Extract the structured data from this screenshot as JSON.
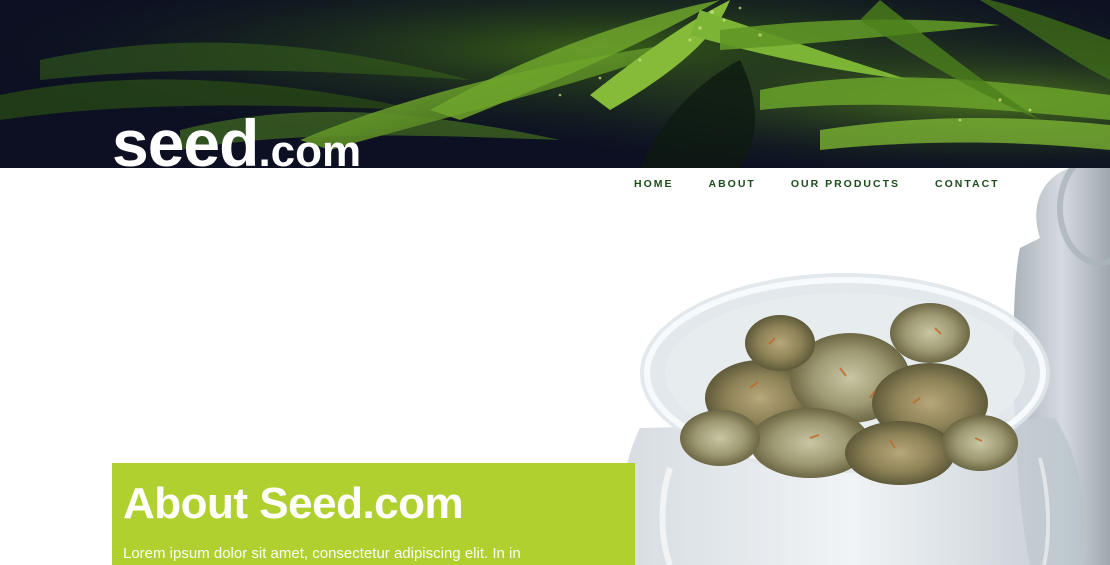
{
  "site": {
    "logo_main": "seed",
    "logo_tld": ".com"
  },
  "nav": {
    "items": [
      {
        "label": "HOME"
      },
      {
        "label": "ABOUT"
      },
      {
        "label": "OUR PRODUCTS"
      },
      {
        "label": "CONTACT"
      }
    ]
  },
  "about": {
    "title": "About Seed.com",
    "text": "Lorem ipsum dolor sit amet, consectetur adipiscing elit. In in"
  },
  "colors": {
    "nav_text": "#1a4d1a",
    "about_bg": "#b0d030",
    "hero_bg": "#0c1022"
  },
  "images": {
    "hero": "cannabis-leaves-photo",
    "jar": "glass-jar-with-buds-photo"
  }
}
